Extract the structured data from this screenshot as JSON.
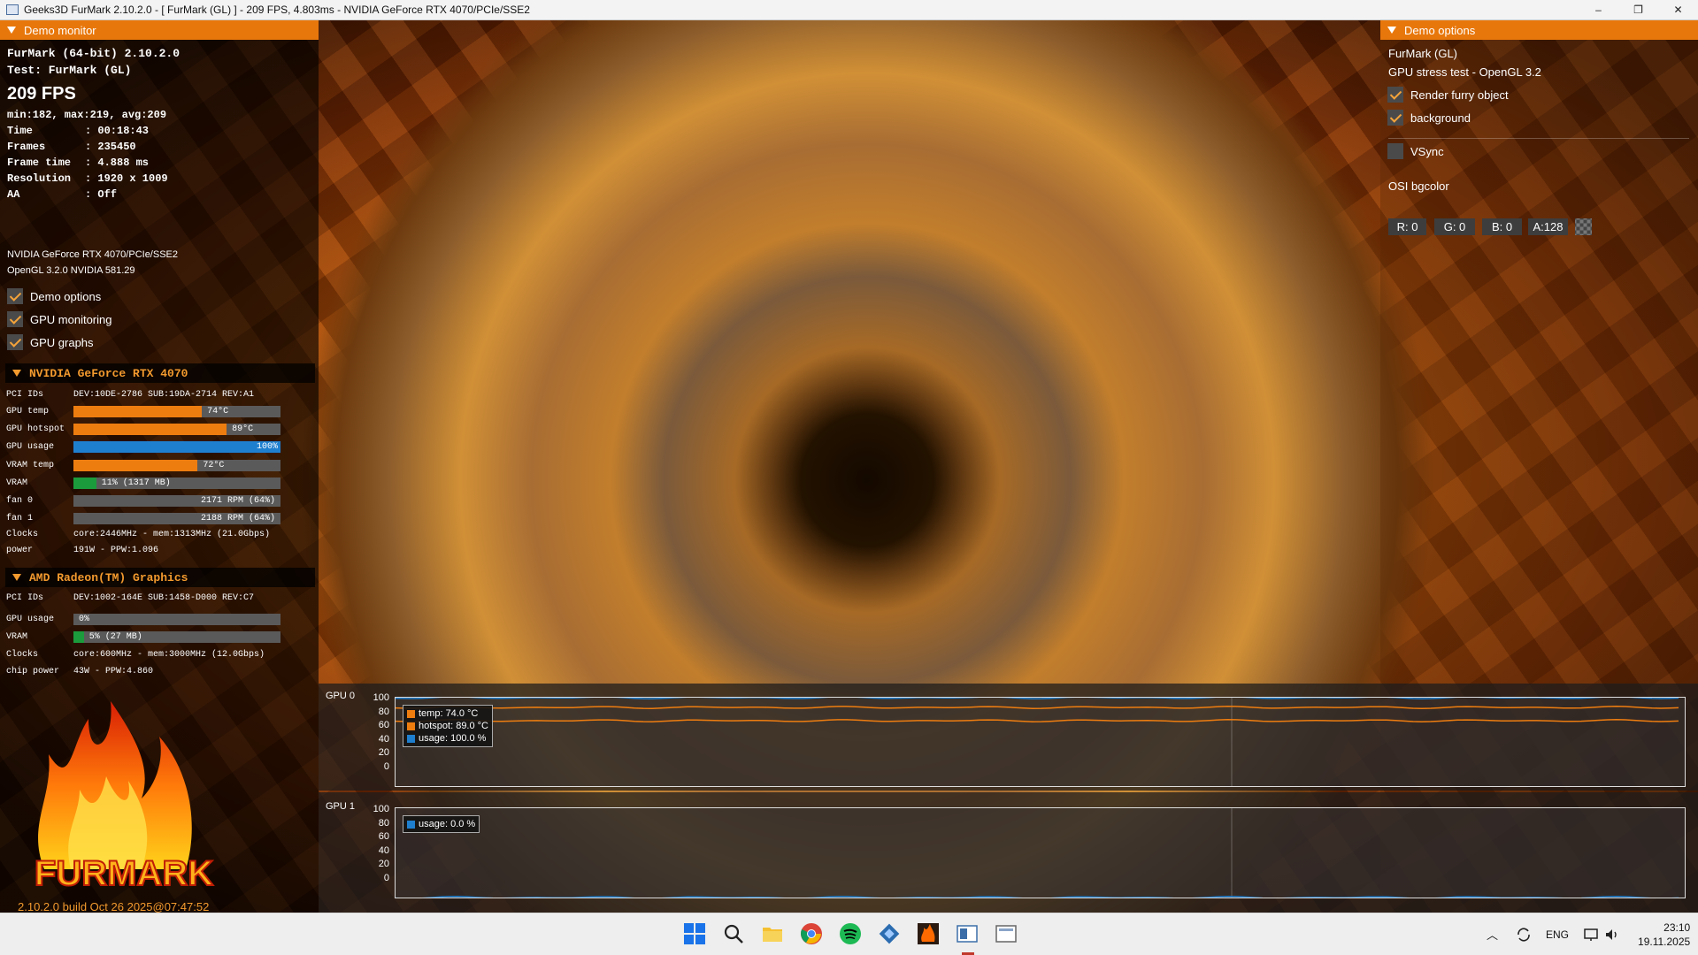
{
  "window": {
    "title": "Geeks3D FurMark 2.10.2.0 - [ FurMark (GL) ] - 209 FPS, 4.803ms - NVIDIA GeForce RTX 4070/PCIe/SSE2",
    "minimize": "–",
    "maximize": "❐",
    "close": "✕"
  },
  "monitor": {
    "header": "Demo monitor",
    "product": "FurMark (64-bit) 2.10.2.0",
    "test": "Test: FurMark (GL)",
    "fps": "209 FPS",
    "fps_stats": "min:182, max:219, avg:209",
    "stats": [
      {
        "label": "Time       ",
        "value": ": 00:18:43"
      },
      {
        "label": "Frames     ",
        "value": ": 235450"
      },
      {
        "label": "Frame time ",
        "value": ": 4.888 ms"
      },
      {
        "label": "Resolution ",
        "value": ": 1920 x 1009"
      },
      {
        "label": "AA         ",
        "value": ": Off"
      }
    ],
    "renderer": "NVIDIA GeForce RTX 4070/PCIe/SSE2",
    "opengl": "OpenGL 3.2.0 NVIDIA 581.29",
    "checkboxes": [
      {
        "label": "Demo options",
        "checked": true
      },
      {
        "label": "GPU monitoring",
        "checked": true
      },
      {
        "label": "GPU graphs",
        "checked": true
      }
    ],
    "gpu0": {
      "name": "NVIDIA GeForce RTX 4070",
      "pci_label": "PCI IDs",
      "pci_value": "DEV:10DE-2786 SUB:19DA-2714 REV:A1",
      "bars": [
        {
          "label": "GPU temp",
          "text": "74°C",
          "fraction": 0.62,
          "color": "#ee7d10"
        },
        {
          "label": "GPU hotspot",
          "text": "89°C",
          "fraction": 0.74,
          "color": "#ee7d10"
        },
        {
          "label": "GPU usage",
          "text": "100%",
          "fraction": 1.0,
          "color": "#1f7fcf"
        },
        {
          "label": "VRAM temp",
          "text": "72°C",
          "fraction": 0.6,
          "color": "#ee7d10"
        },
        {
          "label": "VRAM",
          "text": "11% (1317 MB)",
          "fraction": 0.11,
          "color": "#1c9b3c"
        },
        {
          "label": "fan 0",
          "text": "2171 RPM (64%)",
          "fraction": 0.0,
          "color": "#8a8a8a"
        },
        {
          "label": "fan 1",
          "text": "2188 RPM (64%)",
          "fraction": 0.0,
          "color": "#8a8a8a"
        }
      ],
      "clocks_label": "Clocks",
      "clocks_value": "core:2446MHz - mem:1313MHz (21.0Gbps)",
      "power_label": "power",
      "power_value": "191W - PPW:1.096"
    },
    "gpu1": {
      "name": "AMD Radeon(TM) Graphics",
      "pci_label": "PCI IDs",
      "pci_value": "DEV:1002-164E SUB:1458-D000 REV:C7",
      "bars": [
        {
          "label": "GPU usage",
          "text": "0%",
          "fraction": 0.0,
          "color": "#1f7fcf"
        },
        {
          "label": "VRAM",
          "text": "5% (27 MB)",
          "fraction": 0.05,
          "color": "#1c9b3c"
        }
      ],
      "clocks_label": "Clocks",
      "clocks_value": "core:600MHz - mem:3000MHz (12.0Gbps)",
      "power_label": "chip power",
      "power_value": "43W - PPW:4.860"
    },
    "logo_text": "FURMARK",
    "build": "2.10.2.0 build Oct 26 2025@07:47:52"
  },
  "options": {
    "header": "Demo options",
    "demo_name": "FurMark (GL)",
    "demo_desc": "GPU stress test - OpenGL 3.2",
    "render_furry": {
      "label": "Render furry object",
      "checked": true
    },
    "background": {
      "label": "background",
      "checked": true
    },
    "vsync": {
      "label": "VSync",
      "checked": false
    },
    "osi_label": "OSI bgcolor",
    "r": "R: 0",
    "g": "G: 0",
    "b": "B: 0",
    "a": "A:128"
  },
  "graphs": {
    "gpu0": {
      "label": "GPU 0",
      "yticks": [
        "100",
        "80",
        "60",
        "40",
        "20",
        "0"
      ],
      "legend": [
        {
          "text": "temp: 74.0 °C",
          "color": "#ee7d10"
        },
        {
          "text": "hotspot: 89.0 °C",
          "color": "#ee7d10"
        },
        {
          "text": "usage: 100.0 %",
          "color": "#1f7fcf"
        }
      ],
      "series": {
        "temp": 74,
        "hotspot": 89,
        "usage": 100
      }
    },
    "gpu1": {
      "label": "GPU 1",
      "yticks": [
        "100",
        "80",
        "60",
        "40",
        "20",
        "0"
      ],
      "legend": [
        {
          "text": "usage: 0.0 %",
          "color": "#1f7fcf"
        }
      ],
      "series": {
        "usage": 0
      }
    }
  },
  "taskbar": {
    "lang": "ENG",
    "time": "23:10",
    "date": "19.11.2025"
  }
}
